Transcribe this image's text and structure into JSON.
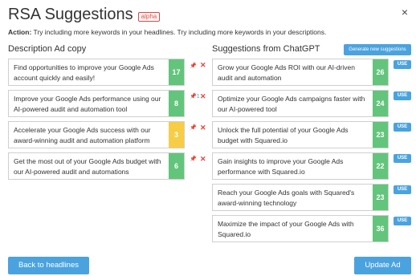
{
  "header": {
    "title": "RSA Suggestions",
    "badge": "alpha",
    "close_icon": "×"
  },
  "action": {
    "label": "Action:",
    "text": " Try including more keywords in your headlines. Try including more keywords in your descriptions."
  },
  "left": {
    "title": "Description Ad copy",
    "items": [
      {
        "text": "Find opportunities to improve your Google Ads account quickly and easily!",
        "score": "17",
        "color": "green",
        "pinned": false,
        "pin_label": ""
      },
      {
        "text": "Improve your Google Ads performance using our AI-powered audit and automation tool",
        "score": "8",
        "color": "green",
        "pinned": true,
        "pin_label": "1"
      },
      {
        "text": "Accelerate your Google Ads success with our award-winning audit and automation platform",
        "score": "3",
        "color": "yellow",
        "pinned": false,
        "pin_label": ""
      },
      {
        "text": "Get the most out of your Google Ads budget with our AI-powered audit and automations",
        "score": "6",
        "color": "green",
        "pinned": false,
        "pin_label": ""
      }
    ]
  },
  "right": {
    "title": "Suggestions from ChatGPT",
    "generate_label": "Generate new suggestions",
    "use_label": "USE",
    "items": [
      {
        "text": "Grow your Google Ads ROI with our AI-driven audit and automation",
        "score": "26"
      },
      {
        "text": "Optimize your Google Ads campaigns faster with our AI-powered tool",
        "score": "24"
      },
      {
        "text": "Unlock the full potential of your Google Ads budget with Squared.io",
        "score": "23"
      },
      {
        "text": "Gain insights to improve your Google Ads performance with Squared.io",
        "score": "22"
      },
      {
        "text": "Reach your Google Ads goals with Squared's award-winning technology",
        "score": "23"
      },
      {
        "text": "Maximize the impact of your Google Ads with Squared.io",
        "score": "36"
      }
    ]
  },
  "footer": {
    "back_label": "Back to headlines",
    "update_label": "Update Ad"
  },
  "colors": {
    "accent": "#4aa3df",
    "score_green": "#62c57b",
    "score_yellow": "#f7cd46",
    "remove_red": "#e0453c"
  }
}
